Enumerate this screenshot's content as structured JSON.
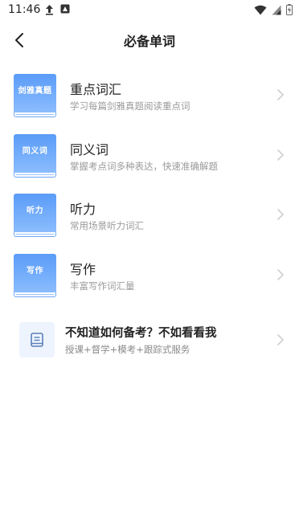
{
  "status_bar": {
    "time": "11:46"
  },
  "header": {
    "title": "必备单词"
  },
  "items": [
    {
      "cover_label": "剑雅真题",
      "title": "重点词汇",
      "subtitle": "学习每篇剑雅真题阅读重点词"
    },
    {
      "cover_label": "同义词",
      "title": "同义词",
      "subtitle": "掌握考点词多种表达，快速准确解题"
    },
    {
      "cover_label": "听力",
      "title": "听力",
      "subtitle": "常用场景听力词汇"
    },
    {
      "cover_label": "写作",
      "title": "写作",
      "subtitle": "丰富写作词汇量"
    }
  ],
  "promo": {
    "title": "不知道如何备考？不如看看我",
    "subtitle": "授课+督学+模考+跟踪式服务"
  },
  "colors": {
    "accent": "#5a9cf8",
    "text": "#222222",
    "muted": "#9a9a9a"
  }
}
